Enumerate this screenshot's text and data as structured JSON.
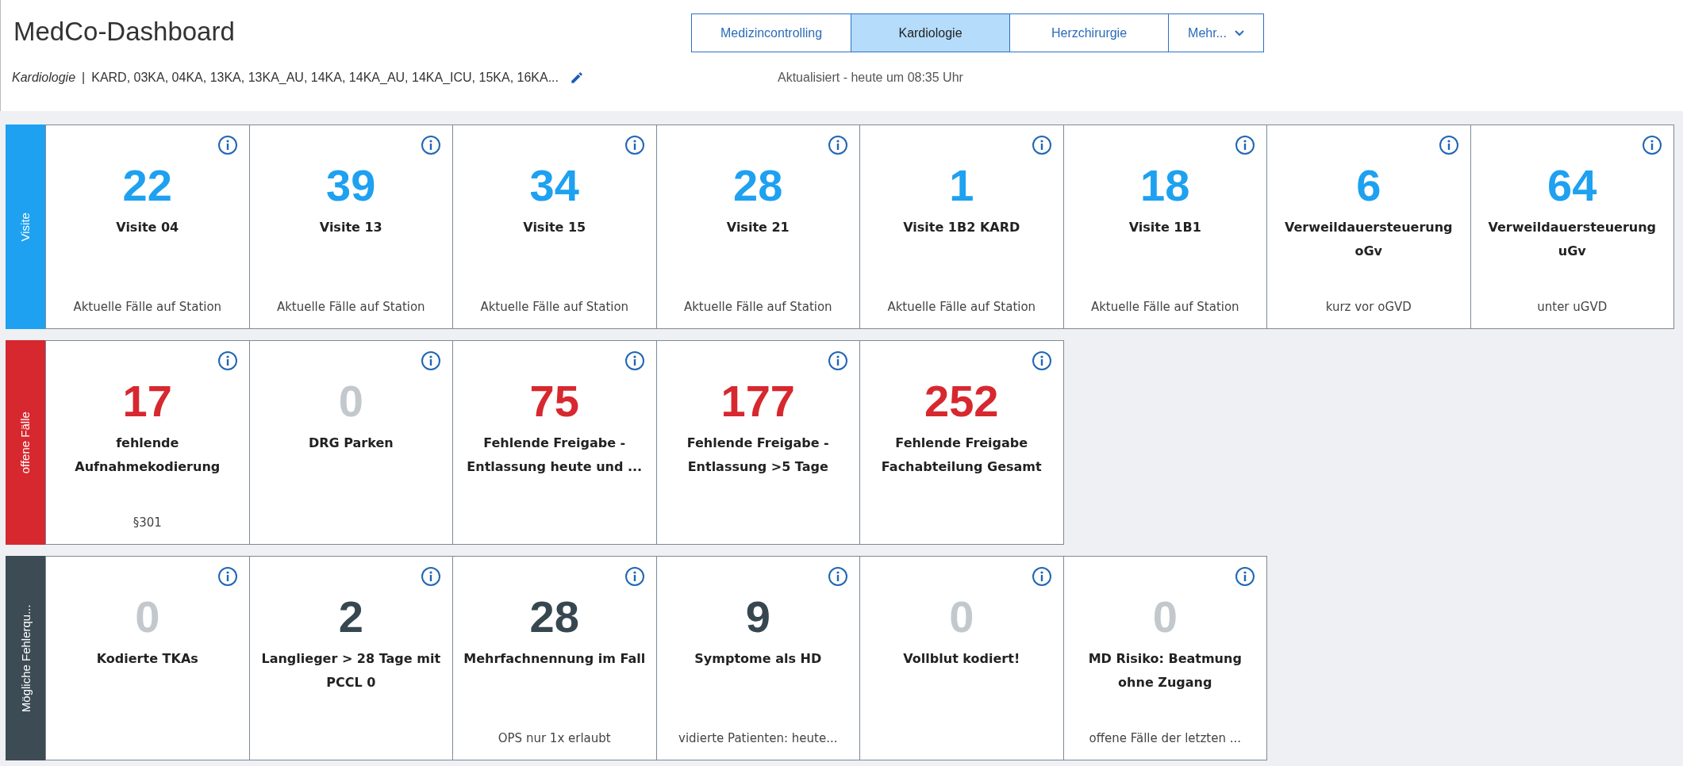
{
  "header": {
    "title": "MedCo-Dashboard",
    "department": "Kardiologie",
    "separator": "|",
    "stations": "KARD, 03KA, 04KA, 13KA, 13KA_AU, 14KA, 14KA_AU, 14KA_ICU, 15KA, 16KA...",
    "updated": "Aktualisiert - heute um 08:35 Uhr"
  },
  "tabs": [
    {
      "label": "Medizincontrolling",
      "selected": false,
      "kind": "tab"
    },
    {
      "label": "Kardiologie",
      "selected": true,
      "kind": "tab"
    },
    {
      "label": "Herzchirurgie",
      "selected": false,
      "kind": "tab"
    },
    {
      "label": "Mehr...",
      "selected": false,
      "kind": "menu"
    }
  ],
  "sections": [
    {
      "label": "Visite",
      "color": "#1ea1f0",
      "cards": [
        {
          "value": "22",
          "color": "#1ea1f0",
          "title": "Visite 04",
          "subtitle": "Aktuelle Fälle auf Station"
        },
        {
          "value": "39",
          "color": "#1ea1f0",
          "title": "Visite 13",
          "subtitle": "Aktuelle Fälle auf Station"
        },
        {
          "value": "34",
          "color": "#1ea1f0",
          "title": "Visite 15",
          "subtitle": "Aktuelle Fälle auf Station"
        },
        {
          "value": "28",
          "color": "#1ea1f0",
          "title": "Visite 21",
          "subtitle": "Aktuelle Fälle auf Station"
        },
        {
          "value": "1",
          "color": "#1ea1f0",
          "title": "Visite 1B2 KARD",
          "subtitle": "Aktuelle Fälle auf Station"
        },
        {
          "value": "18",
          "color": "#1ea1f0",
          "title": "Visite 1B1",
          "subtitle": "Aktuelle Fälle auf Station"
        },
        {
          "value": "6",
          "color": "#1ea1f0",
          "title": "Verweildauersteuerung oGv",
          "subtitle": "kurz vor oGVD"
        },
        {
          "value": "64",
          "color": "#1ea1f0",
          "title": "Verweildauersteuerung uGv",
          "subtitle": "unter uGVD"
        }
      ]
    },
    {
      "label": "offene Fälle",
      "color": "#d7282f",
      "cards": [
        {
          "value": "17",
          "color": "#d7282f",
          "title": "fehlende Aufnahmekodierung",
          "subtitle": "§301"
        },
        {
          "value": "0",
          "color": "#c3c8cc",
          "title": "DRG Parken"
        },
        {
          "value": "75",
          "color": "#d7282f",
          "title": "Fehlende Freigabe - Entlassung heute und ..."
        },
        {
          "value": "177",
          "color": "#d7282f",
          "title": "Fehlende Freigabe - Entlassung >5 Tage"
        },
        {
          "value": "252",
          "color": "#d7282f",
          "title": "Fehlende Freigabe Fachabteilung Gesamt"
        }
      ]
    },
    {
      "label": "Mögliche Fehlerqu...",
      "color": "#3d4b55",
      "cards": [
        {
          "value": "0",
          "color": "#c3c8cc",
          "title": "Kodierte TKAs"
        },
        {
          "value": "2",
          "color": "#37474f",
          "title": "Langlieger > 28 Tage mit PCCL 0"
        },
        {
          "value": "28",
          "color": "#37474f",
          "title": "Mehrfachnennung im Fall",
          "subtitle": "OPS nur 1x erlaubt"
        },
        {
          "value": "9",
          "color": "#37474f",
          "title": "Symptome als HD",
          "subtitle": "vidierte Patienten: heute..."
        },
        {
          "value": "0",
          "color": "#c3c8cc",
          "title": "Vollblut kodiert!"
        },
        {
          "value": "0",
          "color": "#c3c8cc",
          "title": "MD Risiko: Beatmung ohne Zugang",
          "subtitle": "offene Fälle der letzten ..."
        }
      ]
    }
  ]
}
